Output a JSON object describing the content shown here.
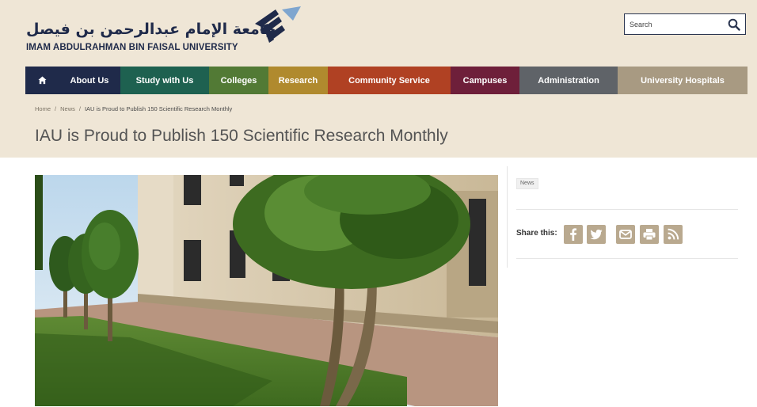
{
  "header": {
    "logo_arabic": "جامعة الإمام عبدالرحمن بن فيصل",
    "logo_english": "IMAM ABDULRAHMAN BIN FAISAL UNIVERSITY",
    "search_placeholder": "Search"
  },
  "nav": {
    "home_icon": "home-icon",
    "items": [
      {
        "label": "About Us",
        "color": "#1f2a4a"
      },
      {
        "label": "Study with Us",
        "color": "#1e6150"
      },
      {
        "label": "Colleges",
        "color": "#527a35"
      },
      {
        "label": "Research",
        "color": "#b08a2e"
      },
      {
        "label": "Community Service",
        "color": "#b04123"
      },
      {
        "label": "Campuses",
        "color": "#6e1f3a"
      },
      {
        "label": "Administration",
        "color": "#5f6368"
      },
      {
        "label": "University Hospitals",
        "color": "#a89a82"
      }
    ]
  },
  "breadcrumb": {
    "home": "Home",
    "news": "News",
    "current": "IAU is Proud to Publish 150 Scientific Research Monthly",
    "separator": "/"
  },
  "page": {
    "title": "IAU is Proud to Publish 150 Scientific Research Monthly"
  },
  "sidebar": {
    "tag": "News",
    "share_label": "Share this:",
    "share_icons": [
      "facebook-icon",
      "twitter-icon",
      "email-icon",
      "print-icon",
      "rss-icon"
    ]
  },
  "colors": {
    "header_bg": "#efe6d6",
    "brand_navy": "#1f2a4a",
    "share_button": "#b9a98f"
  }
}
